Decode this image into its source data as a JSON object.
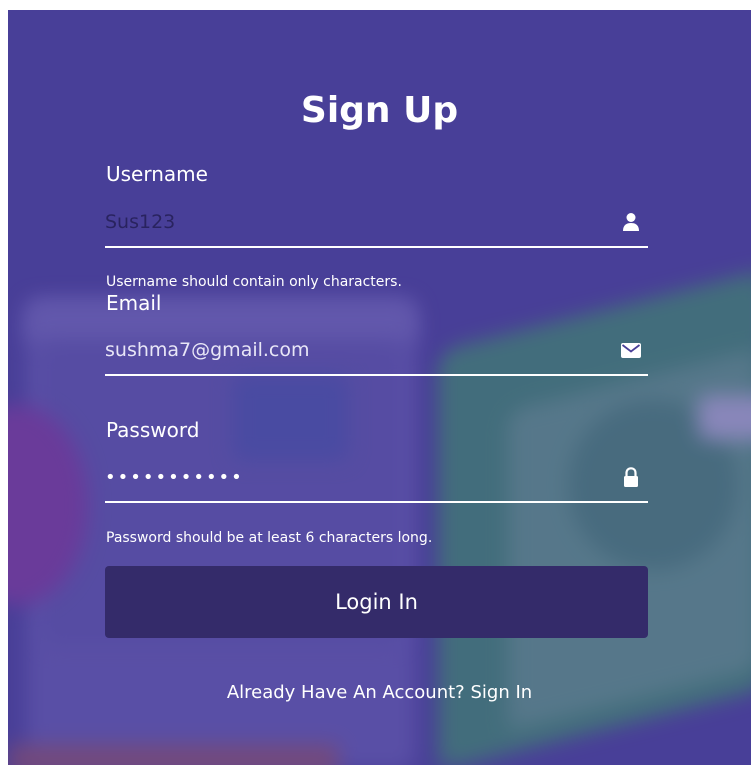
{
  "form": {
    "title": "Sign Up",
    "username": {
      "label": "Username",
      "value": "Sus123",
      "error": "Username should contain only characters.",
      "icon": "user-icon"
    },
    "email": {
      "label": "Email",
      "value": "sushma7@gmail.com",
      "icon": "envelope-icon"
    },
    "password": {
      "label": "Password",
      "value": "sushma12345",
      "error": "Password should be at least 6 characters long.",
      "icon": "lock-icon"
    },
    "submit_label": "Login In",
    "signin_prompt": "Already Have An Account? Sign In"
  },
  "colors": {
    "panel_bg": "#493f98",
    "button_bg": "#342b6a",
    "text": "#ffffff"
  }
}
